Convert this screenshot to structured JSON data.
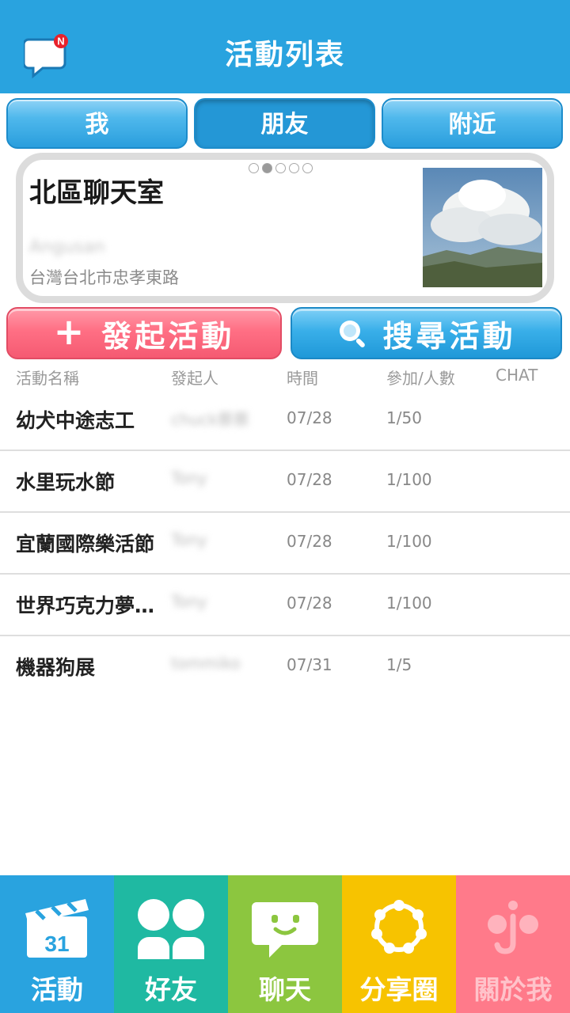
{
  "header": {
    "title": "活動列表",
    "badge": "N",
    "icon": "chat-notification-icon"
  },
  "tabs": [
    {
      "label": "我",
      "active": false
    },
    {
      "label": "朋友",
      "active": true
    },
    {
      "label": "附近",
      "active": false
    }
  ],
  "featured": {
    "title": "北區聊天室",
    "owner": "Angusan",
    "address": "台灣台北市忠孝東路",
    "dots_total": 5,
    "dots_active": 2
  },
  "actions": {
    "create_label": "發起活動",
    "search_label": "搜尋活動",
    "create_color": "#ff6f84",
    "search_color": "#2fa8e5"
  },
  "table": {
    "headers": [
      "活動名稱",
      "發起人",
      "時間",
      "參加/人數",
      "CHAT"
    ],
    "rows": [
      {
        "name": "幼犬中途志工",
        "owner": "chuck蔡蔡",
        "date": "07/28",
        "count": "1/50"
      },
      {
        "name": "水里玩水節",
        "owner": "Tony",
        "date": "07/28",
        "count": "1/100"
      },
      {
        "name": "宜蘭國際樂活節",
        "owner": "Tony",
        "date": "07/28",
        "count": "1/100"
      },
      {
        "name": "世界巧克力夢…",
        "owner": "Tony",
        "date": "07/28",
        "count": "1/100"
      },
      {
        "name": "機器狗展",
        "owner": "tommiko",
        "date": "07/31",
        "count": "1/5"
      }
    ]
  },
  "nav": [
    {
      "label": "活動",
      "icon": "calendar-clapper-icon",
      "color": "#29a3df",
      "icon_text": "31"
    },
    {
      "label": "好友",
      "icon": "friends-icon",
      "color": "#1fb9a2"
    },
    {
      "label": "聊天",
      "icon": "chat-smile-icon",
      "color": "#8cc63f"
    },
    {
      "label": "分享圈",
      "icon": "share-circle-icon",
      "color": "#f7c300"
    },
    {
      "label": "關於我",
      "icon": "about-me-icon",
      "color": "#ff7a8a"
    }
  ]
}
